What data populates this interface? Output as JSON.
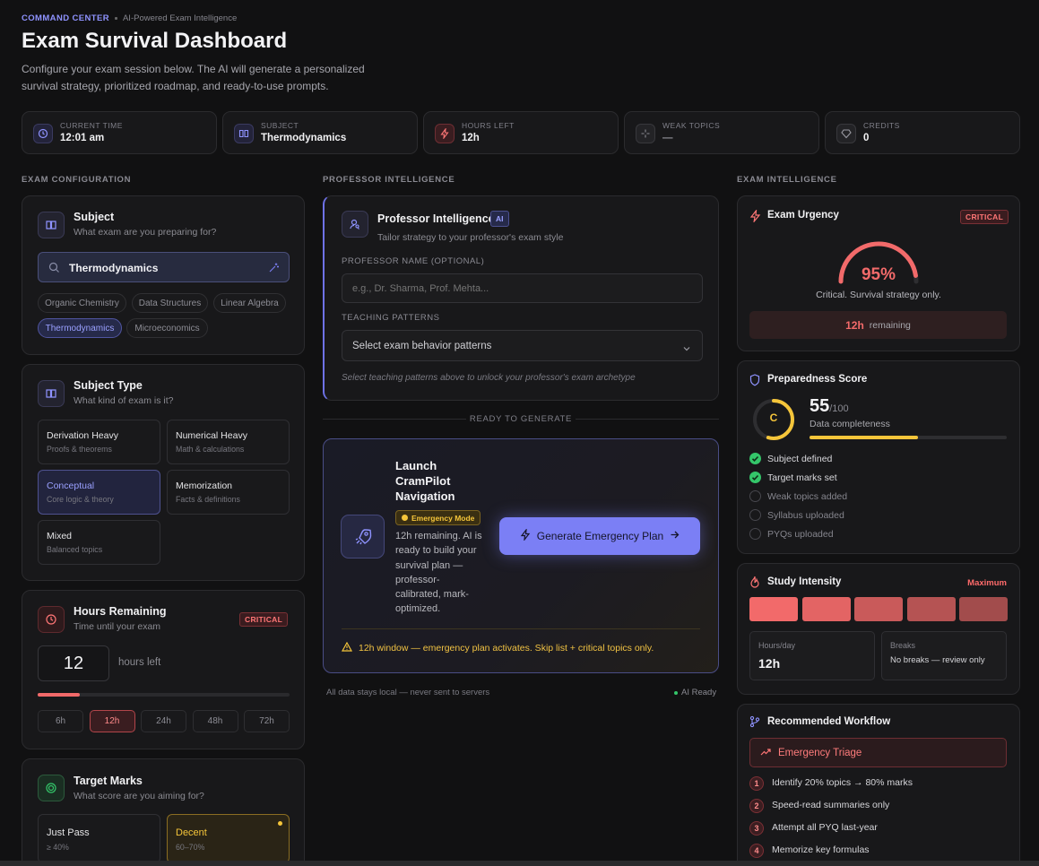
{
  "header": {
    "breadcrumb_main": "COMMAND CENTER",
    "breadcrumb_sub": "AI-Powered Exam Intelligence",
    "title": "Exam Survival Dashboard",
    "desc_line1": "Configure your exam session below. The AI will generate a personalized",
    "desc_line2": "survival strategy, prioritized roadmap, and ready-to-use prompts."
  },
  "stats": [
    {
      "label": "CURRENT TIME",
      "value": "12:01 am"
    },
    {
      "label": "SUBJECT",
      "value": "Thermodynamics"
    },
    {
      "label": "HOURS LEFT",
      "value": "12h"
    },
    {
      "label": "WEAK TOPICS",
      "value": "—"
    },
    {
      "label": "CREDITS",
      "value": "0"
    }
  ],
  "sections": {
    "left": "EXAM CONFIGURATION",
    "middle": "PROFESSOR INTELLIGENCE",
    "right": "EXAM INTELLIGENCE"
  },
  "subject": {
    "title": "Subject",
    "subtitle": "What exam are you preparing for?",
    "value": "Thermodynamics",
    "chips": [
      "Organic Chemistry",
      "Data Structures",
      "Linear Algebra",
      "Thermodynamics",
      "Microeconomics"
    ]
  },
  "subject_type": {
    "title": "Subject Type",
    "subtitle": "What kind of exam is it?",
    "options": [
      {
        "name": "Derivation Heavy",
        "desc": "Proofs & theorems"
      },
      {
        "name": "Numerical Heavy",
        "desc": "Math & calculations"
      },
      {
        "name": "Conceptual",
        "desc": "Core logic & theory"
      },
      {
        "name": "Memorization",
        "desc": "Facts & definitions"
      },
      {
        "name": "Mixed",
        "desc": "Balanced topics"
      }
    ]
  },
  "hours": {
    "title": "Hours Remaining",
    "subtitle": "Time until your exam",
    "badge": "CRITICAL",
    "value": "12",
    "unit": "hours left",
    "progress": 0.167,
    "presets": [
      "6h",
      "12h",
      "24h",
      "48h",
      "72h"
    ]
  },
  "target": {
    "title": "Target Marks",
    "subtitle": "What score are you aiming for?",
    "options": [
      {
        "name": "Just Pass",
        "desc": "≥ 40%"
      },
      {
        "name": "Decent",
        "desc": "60–70%"
      }
    ]
  },
  "professor": {
    "title": "Professor Intelligence",
    "ai_badge": "AI",
    "subtitle": "Tailor strategy to your professor's exam style",
    "name_label": "PROFESSOR NAME (OPTIONAL)",
    "name_placeholder": "e.g., Dr. Sharma, Prof. Mehta...",
    "patterns_label": "TEACHING PATTERNS",
    "patterns_value": "Select exam behavior patterns",
    "hint": "Select teaching patterns above to unlock your professor's exam archetype"
  },
  "divider": "READY TO GENERATE",
  "launch": {
    "title_l1": "Launch",
    "title_l2": "CramPilot",
    "title_l3": "Navigation",
    "mode_badge": "Emergency Mode",
    "desc_lines": [
      "12h remaining. AI is",
      "ready to build your",
      "survival plan —",
      "professor-",
      "calibrated, mark-",
      "optimized."
    ],
    "button": "Generate Emergency Plan",
    "warning": "12h window — emergency plan activates. Skip list + critical topics only."
  },
  "footer": {
    "privacy": "All data stays local — never sent to servers",
    "status": "AI Ready"
  },
  "urgency": {
    "title": "Exam Urgency",
    "badge": "CRITICAL",
    "percent": "95%",
    "value": 0.95,
    "caption": "Critical. Survival strategy only.",
    "remaining_value": "12h",
    "remaining_label": "remaining"
  },
  "preparedness": {
    "title": "Preparedness Score",
    "grade": "C",
    "score": "55",
    "max": "/100",
    "label": "Data completeness",
    "value": 0.55,
    "checklist": [
      {
        "text": "Subject defined",
        "done": true
      },
      {
        "text": "Target marks set",
        "done": true
      },
      {
        "text": "Weak topics added",
        "done": false
      },
      {
        "text": "Syllabus uploaded",
        "done": false
      },
      {
        "text": "PYQs uploaded",
        "done": false
      }
    ]
  },
  "intensity": {
    "title": "Study Intensity",
    "level": "Maximum",
    "bars": 5,
    "hours_label": "Hours/day",
    "hours_value": "12h",
    "breaks_label": "Breaks",
    "breaks_value": "No breaks — review only"
  },
  "workflow": {
    "title": "Recommended Workflow",
    "mode": "Emergency Triage",
    "steps": [
      {
        "n": "1",
        "text": "Identify 20% topics → 80% marks"
      },
      {
        "n": "2",
        "text": "Speed-read summaries only"
      },
      {
        "n": "3",
        "text": "Attempt all PYQ last-year"
      },
      {
        "n": "4",
        "text": "Memorize key formulas"
      }
    ]
  },
  "colors": {
    "accent": "#7b7ff5",
    "critical": "#f26a6a",
    "warning": "#f5c53a",
    "success": "#34c66a"
  }
}
